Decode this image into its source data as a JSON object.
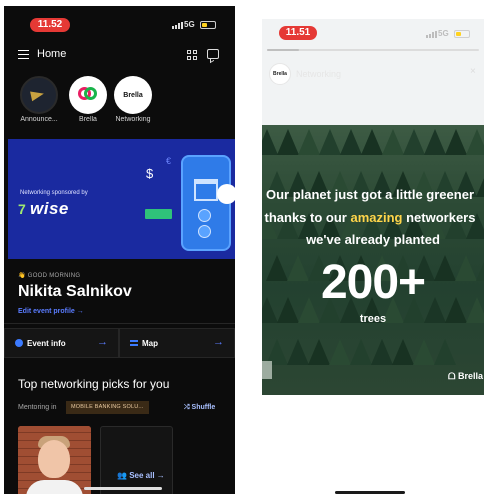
{
  "left_screen": {
    "status": {
      "time": "11.52"
    },
    "header": {
      "title": "Home"
    },
    "stories": [
      {
        "label": "Announce..."
      },
      {
        "label": "Brella"
      },
      {
        "label": "Networking",
        "logo_text": "Brella"
      }
    ],
    "banner": {
      "sponsor_text": "Networking sponsored by",
      "logo": "wise",
      "logo_mark": "7",
      "currency_1": "$",
      "currency_2": "€"
    },
    "greeting": "👋 GOOD MORNING",
    "user_name": "Nikita Salnikov",
    "edit_profile": "Edit event profile →",
    "actions": [
      {
        "label": "Event info",
        "arrow": "→"
      },
      {
        "label": "Map",
        "arrow": "→"
      }
    ],
    "section_title": "Top networking picks for you",
    "mentoring_label": "Mentoring in",
    "mentoring_chip": "MOBILE BANKING SOLU...",
    "shuffle_label": "Shuffle",
    "see_all_label": "See all →"
  },
  "right_screen": {
    "status": {
      "time": "11.51",
      "network": "5G"
    },
    "story_progress": 0.15,
    "story_header": {
      "avatar_text": "Brella",
      "channel": "Networking",
      "close": "×"
    },
    "lines": [
      "Our planet just got a little greener",
      "thanks to our ",
      "amazing",
      " networkers",
      "we've already planted"
    ],
    "big_number": "200+",
    "unit": "trees",
    "brand_mark": "ᗝ Brella"
  },
  "colors": {
    "accent_blue": "#5a7cff",
    "time_pill_red": "#e53935",
    "banner_blue": "#1a2aa0",
    "highlight_yellow": "#ffd54a"
  }
}
